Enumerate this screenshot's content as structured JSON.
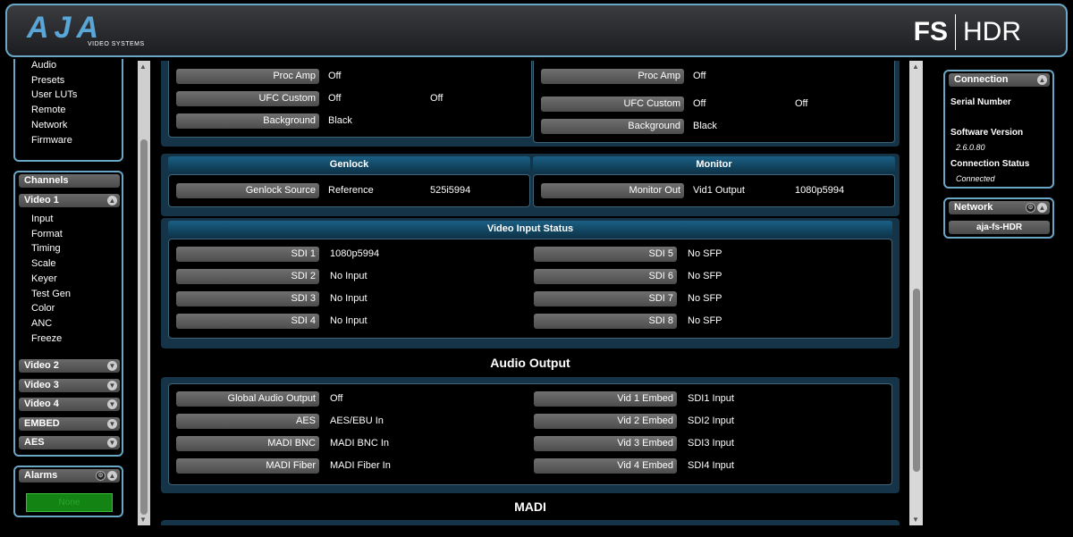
{
  "header": {
    "brand": "AJA",
    "brand_sub": "VIDEO SYSTEMS",
    "product_a": "FS",
    "product_b": "HDR"
  },
  "sidebar": {
    "top_items": [
      "Audio",
      "Presets",
      "User LUTs",
      "Remote",
      "Network",
      "Firmware"
    ],
    "channels_title": "Channels",
    "video1_title": "Video 1",
    "video1_items": [
      "Input",
      "Format",
      "Timing",
      "Scale",
      "Keyer",
      "Test Gen",
      "Color",
      "ANC",
      "Freeze"
    ],
    "collapsed": [
      "Video 2",
      "Video 3",
      "Video 4",
      "EMBED",
      "AES"
    ],
    "alarms_title": "Alarms",
    "alarms_status": "None"
  },
  "main": {
    "top_left": [
      {
        "label": "Proc Amp",
        "value": "Off",
        "value2": ""
      },
      {
        "label": "UFC Custom",
        "value": "Off",
        "value2": "Off"
      },
      {
        "label": "Background",
        "value": "Black",
        "value2": ""
      }
    ],
    "top_right": [
      {
        "label": "Proc Amp",
        "value": "Off",
        "value2": ""
      },
      {
        "label": "UFC Custom",
        "value": "Off",
        "value2": "Off"
      },
      {
        "label": "Background",
        "value": "Black",
        "value2": ""
      }
    ],
    "genlock": {
      "title": "Genlock",
      "label": "Genlock Source",
      "value": "Reference",
      "value2": "525i5994"
    },
    "monitor": {
      "title": "Monitor",
      "label": "Monitor Out",
      "value": "Vid1 Output",
      "value2": "1080p5994"
    },
    "video_input_status": {
      "title": "Video Input Status",
      "left": [
        {
          "label": "SDI 1",
          "value": "1080p5994"
        },
        {
          "label": "SDI 2",
          "value": "No Input"
        },
        {
          "label": "SDI 3",
          "value": "No Input"
        },
        {
          "label": "SDI 4",
          "value": "No Input"
        }
      ],
      "right": [
        {
          "label": "SDI 5",
          "value": "No SFP"
        },
        {
          "label": "SDI 6",
          "value": "No SFP"
        },
        {
          "label": "SDI 7",
          "value": "No SFP"
        },
        {
          "label": "SDI 8",
          "value": "No SFP"
        }
      ]
    },
    "audio_output": {
      "title": "Audio Output",
      "left": [
        {
          "label": "Global Audio Output",
          "value": "Off"
        },
        {
          "label": "AES",
          "value": "AES/EBU In"
        },
        {
          "label": "MADI BNC",
          "value": "MADI BNC In"
        },
        {
          "label": "MADI Fiber",
          "value": "MADI Fiber In"
        }
      ],
      "right": [
        {
          "label": "Vid 1 Embed",
          "value": "SDI1 Input"
        },
        {
          "label": "Vid 2 Embed",
          "value": "SDI2 Input"
        },
        {
          "label": "Vid 3 Embed",
          "value": "SDI3 Input"
        },
        {
          "label": "Vid 4 Embed",
          "value": "SDI4 Input"
        }
      ]
    },
    "madi_title": "MADI"
  },
  "right": {
    "connection_title": "Connection",
    "serial_label": "Serial Number",
    "software_label": "Software Version",
    "software_value": "2.6.0.80",
    "status_label": "Connection Status",
    "status_value": "Connected",
    "network_title": "Network",
    "network_value": "aja-fs-HDR"
  }
}
